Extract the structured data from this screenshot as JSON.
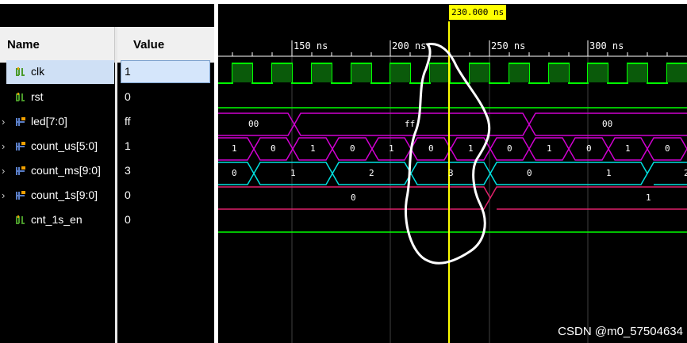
{
  "names_panel": {
    "header_name": "Name",
    "header_value": "Value",
    "signals": [
      {
        "name": "clk",
        "value": "1",
        "type": "bit",
        "expandable": false,
        "selected": true
      },
      {
        "name": "rst",
        "value": "0",
        "type": "bit",
        "expandable": false,
        "selected": false
      },
      {
        "name": "led[7:0]",
        "value": "ff",
        "type": "bus",
        "expandable": true,
        "selected": false
      },
      {
        "name": "count_us[5:0]",
        "value": "1",
        "type": "bus",
        "expandable": true,
        "selected": false
      },
      {
        "name": "count_ms[9:0]",
        "value": "3",
        "type": "bus",
        "expandable": true,
        "selected": false
      },
      {
        "name": "count_1s[9:0]",
        "value": "0",
        "type": "bus",
        "expandable": true,
        "selected": false
      },
      {
        "name": "cnt_1s_en",
        "value": "0",
        "type": "bit",
        "expandable": false,
        "selected": false
      }
    ]
  },
  "waveform": {
    "cursor_time": "230.000 ns",
    "ticks": [
      "150 ns",
      "200 ns",
      "250 ns",
      "300 ns"
    ],
    "led_values": [
      "00",
      "ff",
      "00"
    ],
    "count_us_values": [
      "1",
      "0",
      "1",
      "0",
      "1",
      "0",
      "1",
      "0",
      "1",
      "0",
      "1",
      "0"
    ],
    "count_ms_values": [
      "0",
      "1",
      "2",
      "3",
      "0",
      "1",
      "2"
    ],
    "count_1s_values": [
      "0",
      "1"
    ]
  },
  "colors": {
    "clk": "#00ff00",
    "bus_magenta": "#d000d0",
    "bus_cyan": "#00e0e0",
    "count_1s": "#e0206a",
    "cursor": "#ffff00",
    "grid": "#404040"
  },
  "icons": {
    "bit_signal": "bit-signal-icon",
    "bus_signal": "bus-signal-icon",
    "expand": "chevron-right-icon"
  },
  "watermark": "CSDN @m0_57504634"
}
